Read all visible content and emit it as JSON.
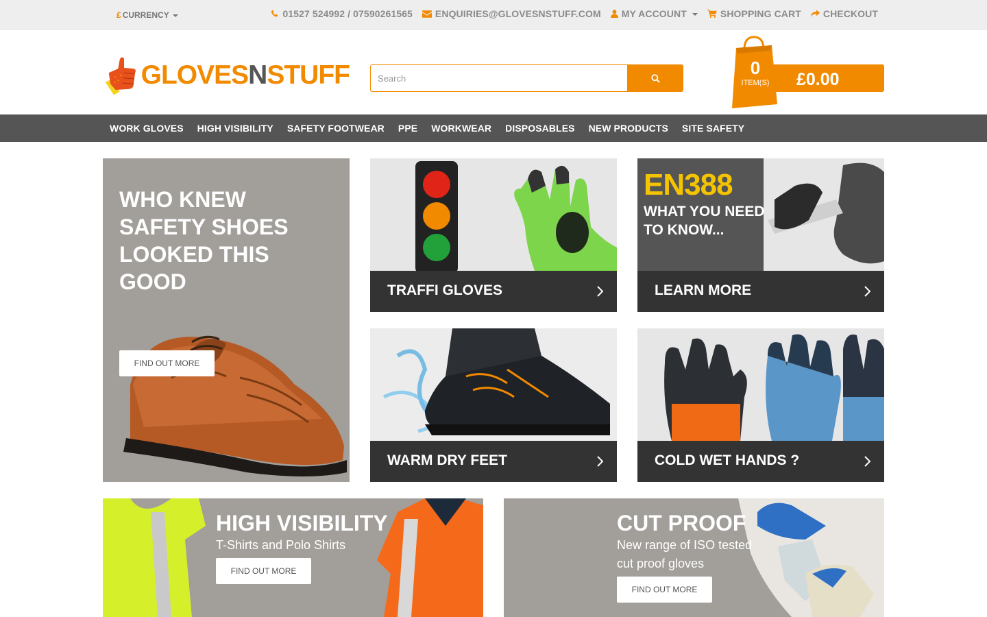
{
  "topbar": {
    "currency": "CURRENCY",
    "currency_symbol": "£",
    "phone": "01527 524992 / 07590261565",
    "email": "ENQUIRIES@GLOVESNSTUFF.COM",
    "account": "MY ACCOUNT",
    "cart": "SHOPPING CART",
    "checkout": "CHECKOUT"
  },
  "header": {
    "logo_part1": "GLOVES",
    "logo_part2": "N",
    "logo_part3": "STUFF",
    "search_placeholder": "Search",
    "cart_count": "0",
    "cart_items_label": "ITEM(S)",
    "cart_total": "£0.00"
  },
  "nav": {
    "items": [
      "WORK GLOVES",
      "HIGH VISIBILITY",
      "SAFETY FOOTWEAR",
      "PPE",
      "WORKWEAR",
      "DISPOSABLES",
      "NEW PRODUCTS",
      "SITE SAFETY"
    ]
  },
  "hero": {
    "title": "WHO KNEW SAFETY SHOES LOOKED THIS GOOD",
    "button": "FIND OUT MORE"
  },
  "cards": [
    {
      "caption": "TRAFFI GLOVES"
    },
    {
      "caption": "LEARN MORE",
      "overlay_title": "EN388",
      "overlay_sub": "WHAT YOU NEED TO KNOW..."
    },
    {
      "caption": "WARM DRY FEET"
    },
    {
      "caption": "COLD WET HANDS ?"
    }
  ],
  "banners": [
    {
      "title": "HIGH VISIBILITY",
      "subtitle": "T-Shirts and Polo Shirts",
      "button": "FIND OUT MORE"
    },
    {
      "title": "CUT PROOF",
      "subtitle": "New range of ISO tested cut proof gloves",
      "button": "FIND OUT MORE"
    }
  ],
  "colors": {
    "accent": "#f28a00",
    "nav_bg": "#555555",
    "caption_bg": "#333333",
    "tile_grey": "#a29e99"
  }
}
